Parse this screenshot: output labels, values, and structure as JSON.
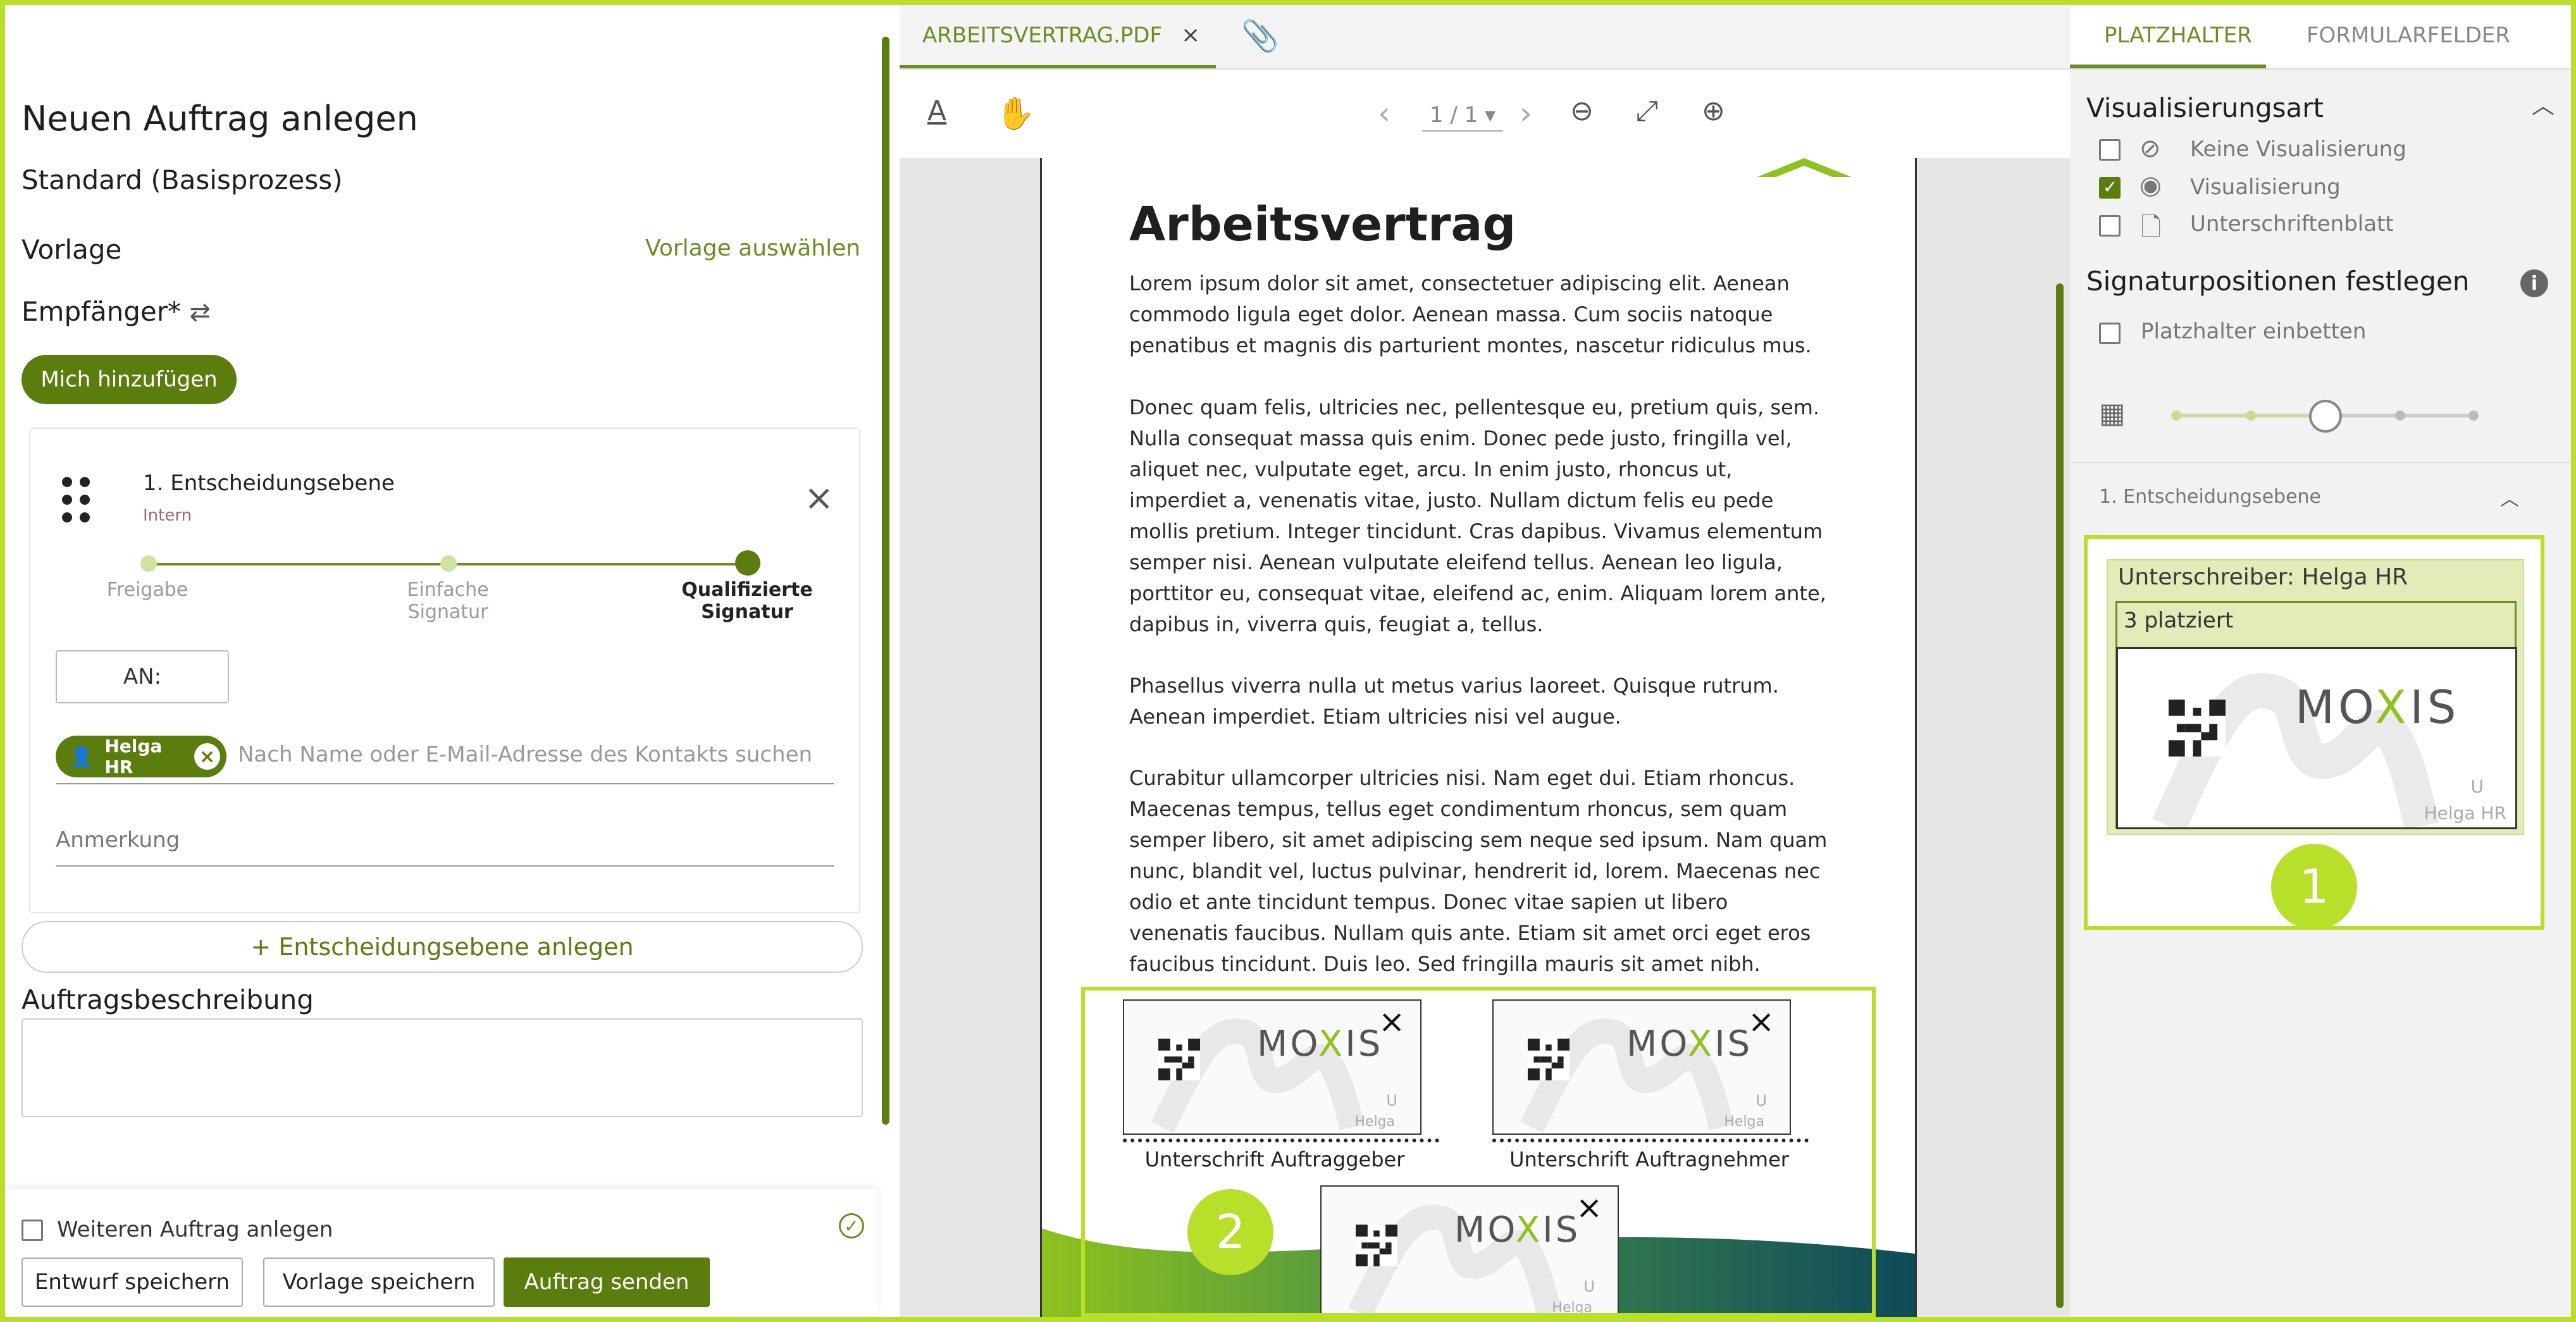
{
  "left": {
    "title": "Neuen Auftrag anlegen",
    "process": "Standard (Basisprozess)",
    "vorlage_label": "Vorlage",
    "vorlage_link": "Vorlage auswählen",
    "empfaenger_label": "Empfänger*",
    "add_me": "Mich hinzufügen",
    "level": {
      "title": "1. Entscheidungsebene",
      "subtitle": "Intern",
      "steps": [
        "Freigabe",
        "Einfache Signatur",
        "Qualifizierte Signatur"
      ],
      "an_label": "AN:",
      "chip_name": "Helga HR",
      "search_placeholder": "Nach Name oder E-Mail-Adresse des Kontakts suchen",
      "anmerkung": "Anmerkung"
    },
    "add_level": "+ Entscheidungsebene anlegen",
    "desc_label": "Auftragsbeschreibung",
    "footer": {
      "another_label": "Weiteren Auftrag anlegen",
      "save_draft": "Entwurf speichern",
      "save_template": "Vorlage speichern",
      "send": "Auftrag senden"
    }
  },
  "middle": {
    "tab_name": "ARBEITSVERTRAG.PDF",
    "tab_close": "×",
    "pager": "1 / 1 ▾",
    "doc_title": "Arbeitsvertrag",
    "paragraphs": [
      "Lorem ipsum dolor sit amet, consectetuer adipiscing elit. Aenean commodo ligula eget dolor. Aenean massa. Cum sociis natoque penatibus et magnis dis parturient montes, nascetur ridiculus mus.",
      "Donec quam felis, ultricies nec, pellentesque eu, pretium quis, sem. Nulla consequat massa quis enim. Donec pede justo, fringilla vel, aliquet nec, vulputate eget, arcu. In enim justo, rhoncus ut, imperdiet a, venenatis vitae, justo. Nullam dictum felis eu pede mollis pretium. Integer tincidunt. Cras dapibus. Vivamus elementum semper nisi. Aenean vulputate eleifend tellus. Aenean leo ligula, porttitor eu, consequat vitae, eleifend ac, enim. Aliquam lorem ante, dapibus in, viverra quis, feugiat a, tellus.",
      "Phasellus viverra nulla ut metus varius laoreet. Quisque rutrum. Aenean imperdiet. Etiam ultricies nisi vel augue.",
      "Curabitur ullamcorper ultricies nisi. Nam eget dui. Etiam rhoncus. Maecenas tempus, tellus eget condimentum rhoncus, sem quam semper libero, sit amet adipiscing sem neque sed ipsum. Nam quam nunc, blandit vel, luctus pulvinar, hendrerit id, lorem. Maecenas nec odio et ante tincidunt tempus. Donec vitae sapien ut libero venenatis faucibus. Nullam quis ante. Etiam sit amet orci eget eros faucibus tincidunt. Duis leo. Sed fringilla mauris sit amet nibh."
    ],
    "sig_caption_1": "Unterschrift Auftraggeber",
    "sig_caption_2": "Unterschrift Auftragnehmer",
    "sig_logo_left": "MO",
    "sig_logo_x": "X",
    "sig_logo_right": "IS",
    "sig_u": "U",
    "sig_name": "Helga",
    "badge": "2"
  },
  "right": {
    "tab_placeholder": "PLATZHALTER",
    "tab_fields": "FORMULARFELDER",
    "vis_title": "Visualisierungsart",
    "vis_options": [
      "Keine Visualisierung",
      "Visualisierung",
      "Unterschriftenblatt"
    ],
    "sigpos_title": "Signaturpositionen festlegen",
    "embed_label": "Platzhalter einbetten",
    "level_label": "1. Entscheidungsebene",
    "signer_title": "Unterschreiber: Helga HR",
    "placed": "3 platziert",
    "sig_name": "Helga HR",
    "badge": "1"
  },
  "colors": {
    "accent": "#5b7d0e",
    "highlight": "#b8e02b"
  }
}
